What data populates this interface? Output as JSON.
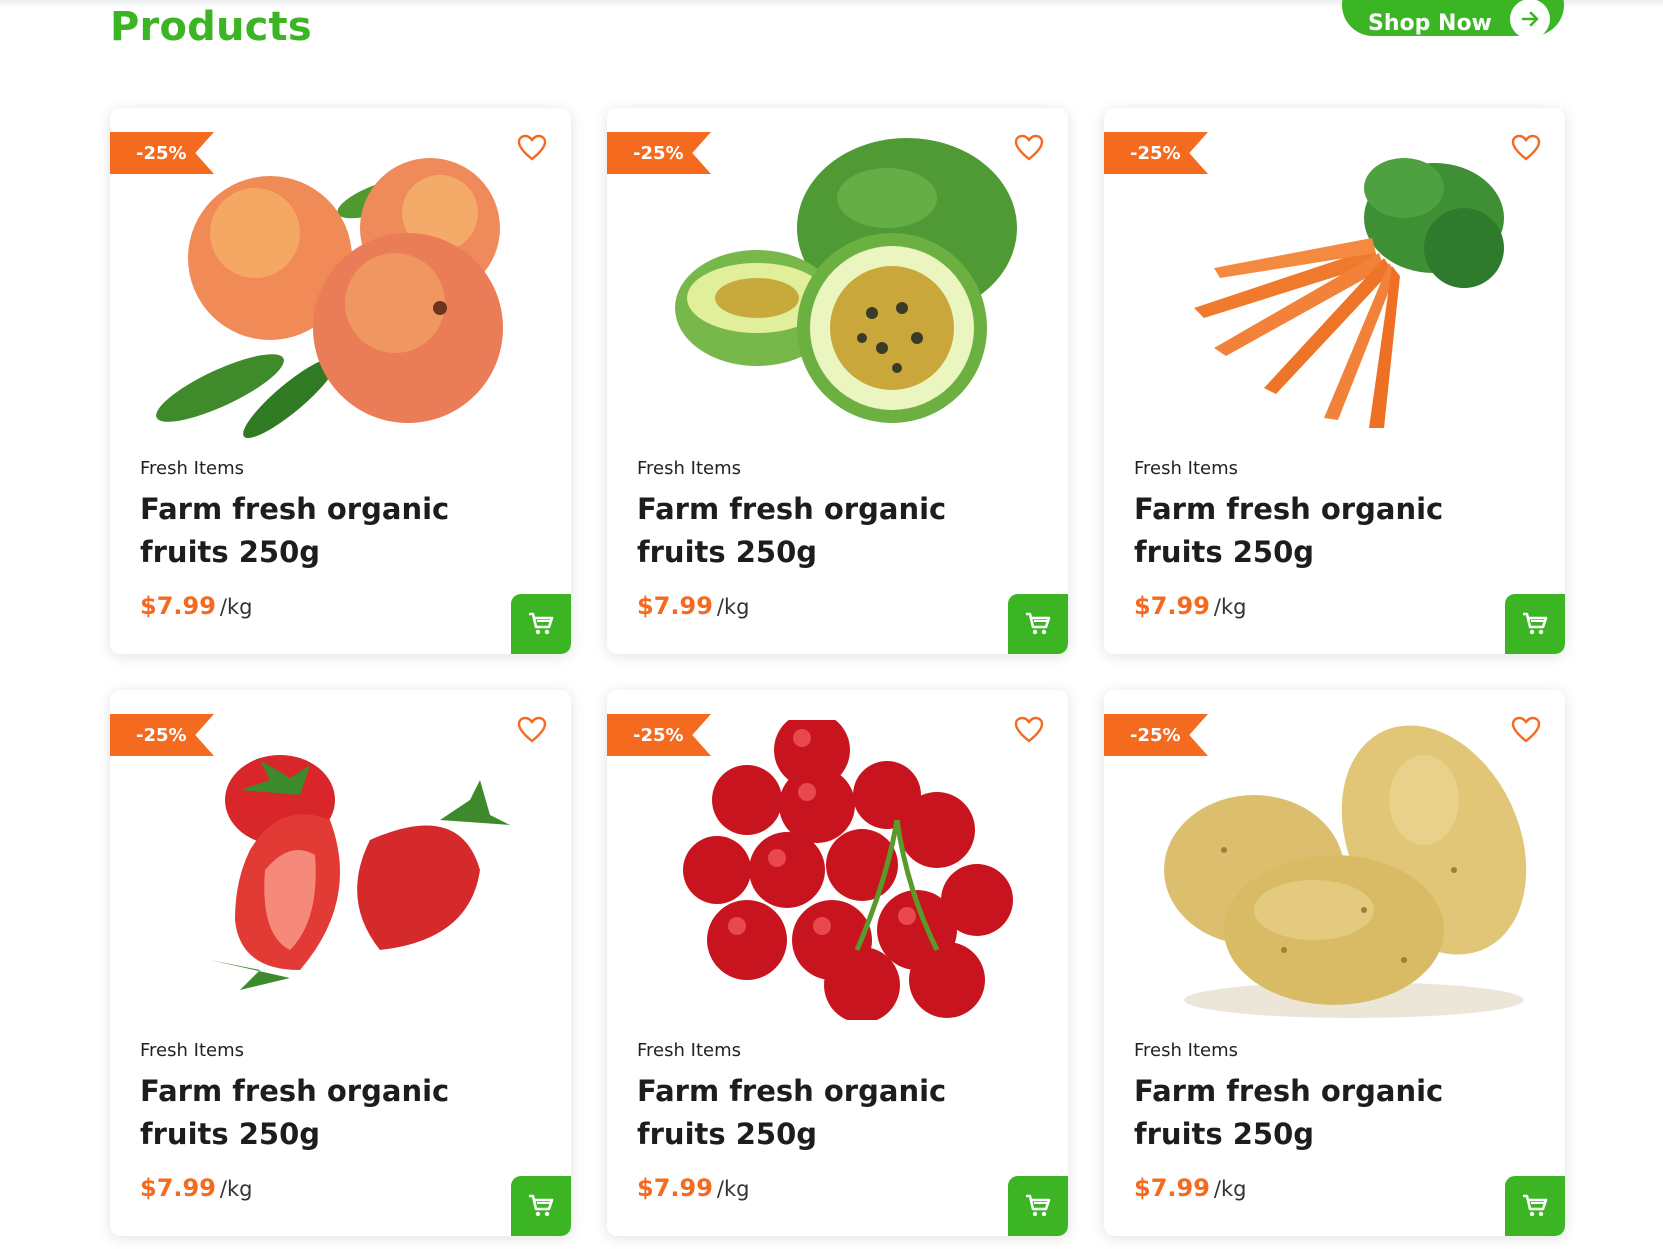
{
  "section": {
    "title": "Products",
    "shop_button_label": "Shop Now"
  },
  "colors": {
    "brand_green": "#3bb523",
    "accent_orange": "#f46a1e"
  },
  "products": [
    {
      "badge": "-25%",
      "category": "Fresh Items",
      "name": "Farm fresh organic fruits 250g",
      "price": "$7.99",
      "unit": "/kg",
      "image": "peaches"
    },
    {
      "badge": "-25%",
      "category": "Fresh Items",
      "name": "Farm fresh organic fruits 250g",
      "price": "$7.99",
      "unit": "/kg",
      "image": "passion-fruit"
    },
    {
      "badge": "-25%",
      "category": "Fresh Items",
      "name": "Farm fresh organic fruits 250g",
      "price": "$7.99",
      "unit": "/kg",
      "image": "carrots"
    },
    {
      "badge": "-25%",
      "category": "Fresh Items",
      "name": "Farm fresh organic fruits 250g",
      "price": "$7.99",
      "unit": "/kg",
      "image": "strawberries"
    },
    {
      "badge": "-25%",
      "category": "Fresh Items",
      "name": "Farm fresh organic fruits 250g",
      "price": "$7.99",
      "unit": "/kg",
      "image": "cherries"
    },
    {
      "badge": "-25%",
      "category": "Fresh Items",
      "name": "Farm fresh organic fruits 250g",
      "price": "$7.99",
      "unit": "/kg",
      "image": "potatoes"
    }
  ]
}
